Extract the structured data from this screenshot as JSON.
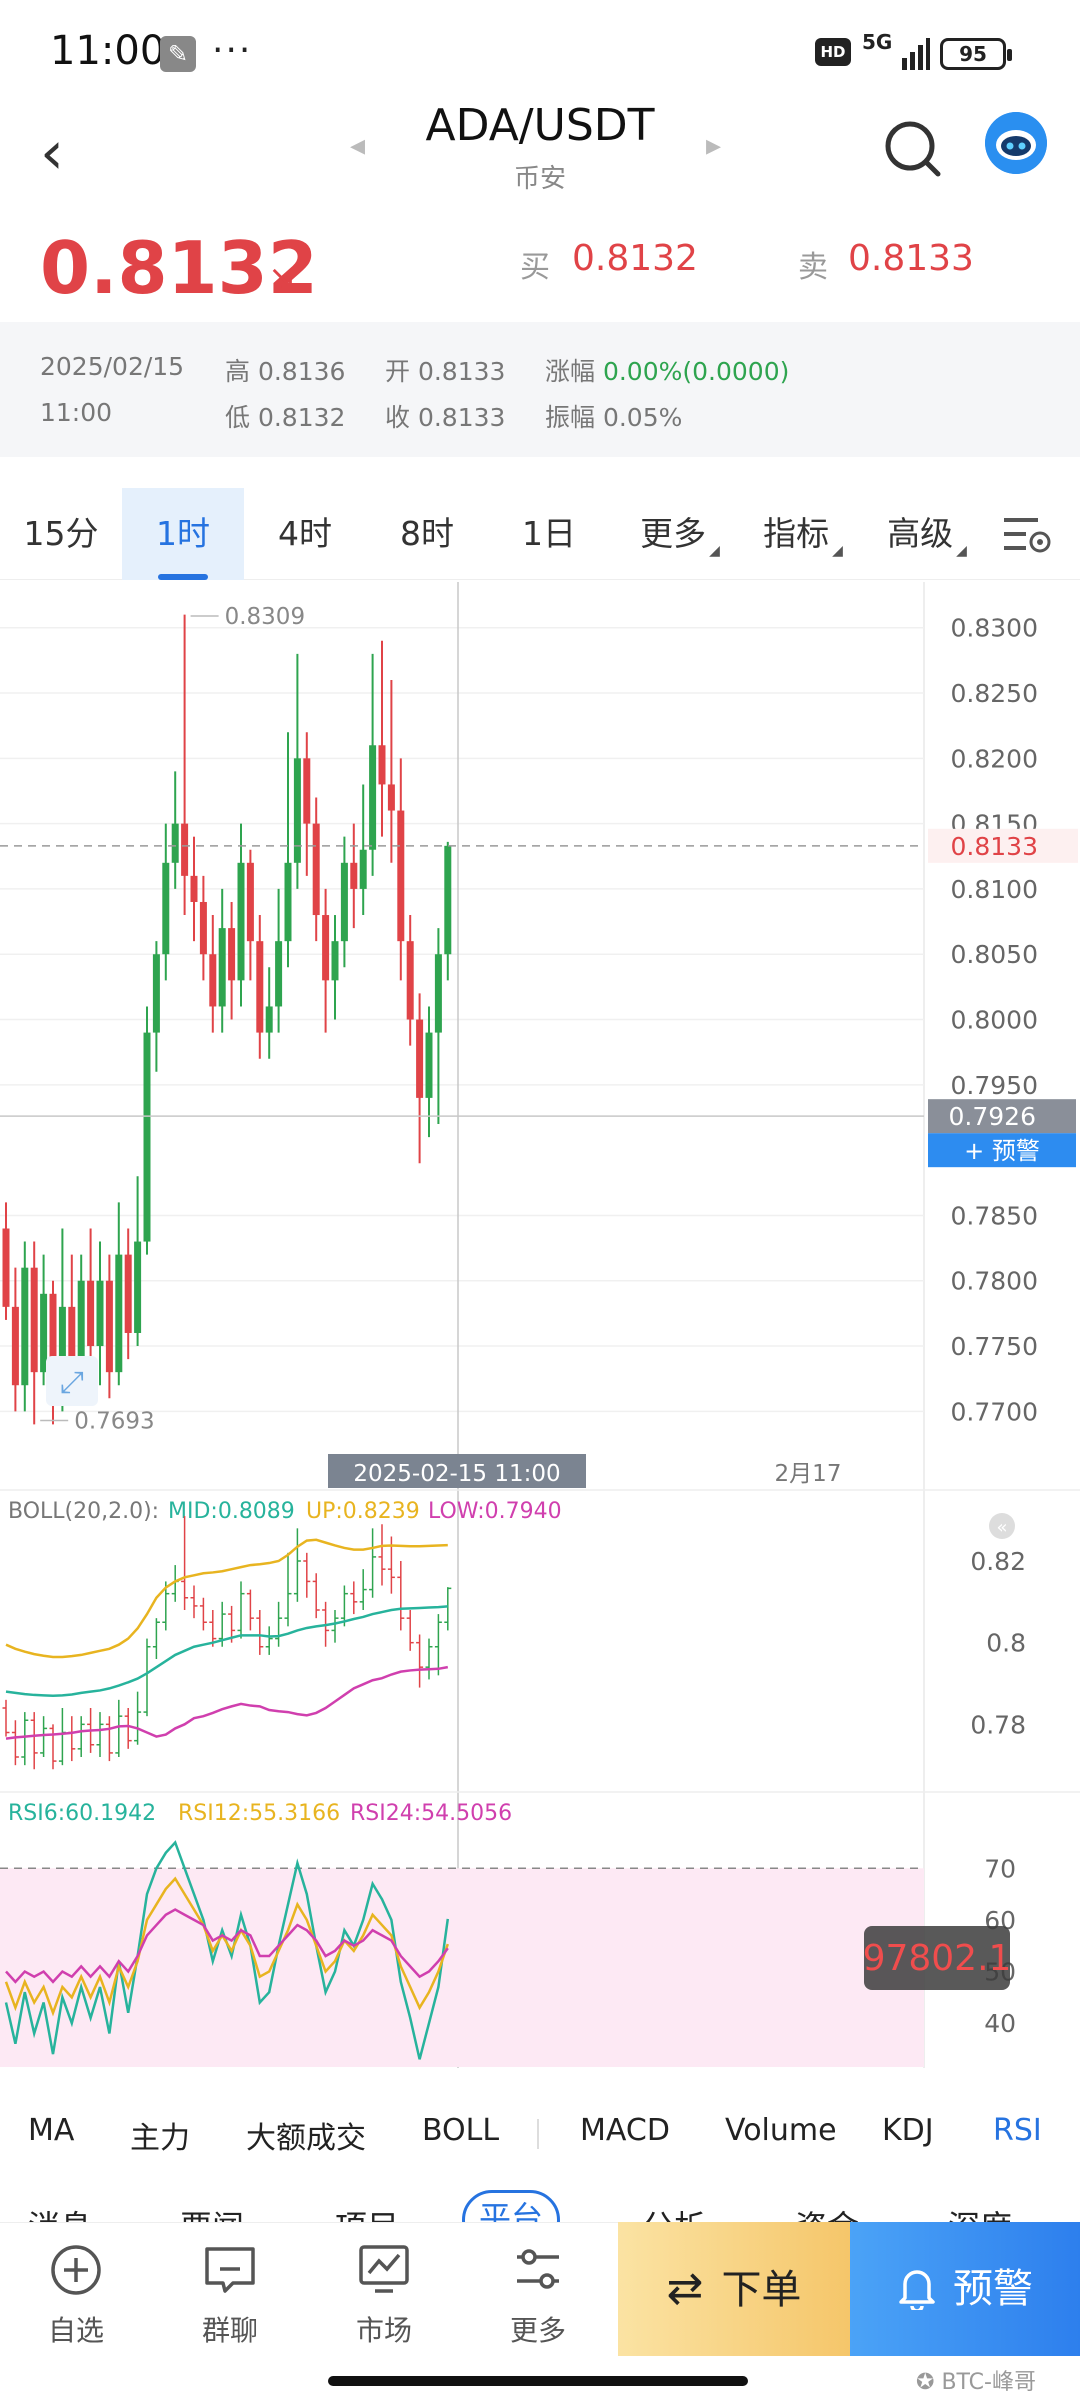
{
  "status_bar": {
    "time": "11:00",
    "dots": "···",
    "hd": "HD",
    "network": "5G",
    "battery": "95"
  },
  "header": {
    "pair": "ADA/USDT",
    "exchange": "币安",
    "back_icon": "chevron-left-icon",
    "search_icon": "search-icon",
    "avatar_icon": "robot-avatar-icon"
  },
  "price": {
    "last": "0.8132",
    "direction": "↘",
    "bid_label": "买",
    "bid": "0.8132",
    "ask_label": "卖",
    "ask": "0.8133"
  },
  "stats": {
    "date": "2025/02/15",
    "time": "11:00",
    "high": "高 0.8136",
    "low": "低 0.8132",
    "open": "开 0.8133",
    "close": "收 0.8133",
    "change_label": "涨幅 ",
    "change_value": "0.00%(0.0000)",
    "amplitude": "振幅 0.05%"
  },
  "timeframes": [
    {
      "label": "15分"
    },
    {
      "label": "1时",
      "active": true
    },
    {
      "label": "4时"
    },
    {
      "label": "8时"
    },
    {
      "label": "1日"
    },
    {
      "label": "更多",
      "dropdown": true
    },
    {
      "label": "指标",
      "dropdown": true
    },
    {
      "label": "高级",
      "dropdown": true
    }
  ],
  "colors": {
    "up": "#2ea44f",
    "down": "#e04347",
    "accent": "#2673e0",
    "boll_mid": "#27b39c",
    "boll_up": "#e8b420",
    "boll_low": "#d03fae",
    "rsi6": "#27b39c",
    "rsi12": "#e8b420",
    "rsi24": "#d03fae"
  },
  "chart_data": [
    {
      "type": "candlestick",
      "title": "",
      "y_ticks": [
        "0.8300",
        "0.8250",
        "0.8200",
        "0.8150",
        "0.8100",
        "0.8050",
        "0.8000",
        "0.7950",
        "0.7850",
        "0.7800",
        "0.7750",
        "0.7700"
      ],
      "ylim": [
        0.7675,
        0.8335
      ],
      "x_labels": [
        "2月17"
      ],
      "last_price_label": "0.8133",
      "crosshair_price_label": "0.7926",
      "crosshair_time_label": "2025-02-15 11:00",
      "max_label": "0.8309",
      "min_label": "0.7693",
      "alert_button": "+ 预警",
      "candles": [
        [
          0.784,
          0.778,
          0.786,
          0.777
        ],
        [
          0.778,
          0.772,
          0.781,
          0.77
        ],
        [
          0.772,
          0.781,
          0.783,
          0.77
        ],
        [
          0.781,
          0.773,
          0.783,
          0.769
        ],
        [
          0.773,
          0.779,
          0.782,
          0.772
        ],
        [
          0.779,
          0.771,
          0.78,
          0.769
        ],
        [
          0.771,
          0.778,
          0.784,
          0.77
        ],
        [
          0.778,
          0.774,
          0.782,
          0.771
        ],
        [
          0.774,
          0.78,
          0.782,
          0.772
        ],
        [
          0.78,
          0.775,
          0.784,
          0.773
        ],
        [
          0.775,
          0.78,
          0.783,
          0.772
        ],
        [
          0.78,
          0.773,
          0.782,
          0.771
        ],
        [
          0.773,
          0.782,
          0.786,
          0.772
        ],
        [
          0.782,
          0.776,
          0.784,
          0.774
        ],
        [
          0.776,
          0.783,
          0.788,
          0.775
        ],
        [
          0.783,
          0.799,
          0.801,
          0.782
        ],
        [
          0.799,
          0.805,
          0.806,
          0.796
        ],
        [
          0.805,
          0.812,
          0.815,
          0.803
        ],
        [
          0.812,
          0.815,
          0.819,
          0.81
        ],
        [
          0.815,
          0.811,
          0.831,
          0.808
        ],
        [
          0.811,
          0.809,
          0.814,
          0.806
        ],
        [
          0.809,
          0.805,
          0.811,
          0.803
        ],
        [
          0.805,
          0.801,
          0.808,
          0.799
        ],
        [
          0.801,
          0.807,
          0.81,
          0.799
        ],
        [
          0.807,
          0.803,
          0.809,
          0.8
        ],
        [
          0.803,
          0.812,
          0.815,
          0.801
        ],
        [
          0.812,
          0.806,
          0.813,
          0.803
        ],
        [
          0.806,
          0.799,
          0.808,
          0.797
        ],
        [
          0.799,
          0.801,
          0.804,
          0.797
        ],
        [
          0.801,
          0.806,
          0.81,
          0.799
        ],
        [
          0.806,
          0.812,
          0.822,
          0.804
        ],
        [
          0.812,
          0.82,
          0.828,
          0.81
        ],
        [
          0.82,
          0.815,
          0.822,
          0.811
        ],
        [
          0.815,
          0.808,
          0.817,
          0.806
        ],
        [
          0.808,
          0.803,
          0.81,
          0.799
        ],
        [
          0.803,
          0.806,
          0.808,
          0.8
        ],
        [
          0.806,
          0.812,
          0.814,
          0.804
        ],
        [
          0.812,
          0.81,
          0.815,
          0.807
        ],
        [
          0.81,
          0.813,
          0.818,
          0.808
        ],
        [
          0.813,
          0.821,
          0.828,
          0.811
        ],
        [
          0.821,
          0.818,
          0.829,
          0.814
        ],
        [
          0.818,
          0.816,
          0.826,
          0.812
        ],
        [
          0.816,
          0.806,
          0.82,
          0.803
        ],
        [
          0.806,
          0.8,
          0.808,
          0.798
        ],
        [
          0.8,
          0.794,
          0.802,
          0.789
        ],
        [
          0.794,
          0.799,
          0.801,
          0.791
        ],
        [
          0.799,
          0.805,
          0.807,
          0.792
        ],
        [
          0.805,
          0.8133,
          0.8136,
          0.803
        ]
      ]
    },
    {
      "type": "line",
      "legend": "BOLL(20,2.0):",
      "series_labels": [
        "MID:0.8089",
        "UP:0.8239",
        "LOW:0.7940"
      ],
      "y_ticks": [
        "0.82",
        "0.8",
        "0.78"
      ],
      "ylim": [
        0.772,
        0.832
      ],
      "series": [
        {
          "name": "MID",
          "values": [
            0.788,
            0.7877,
            0.7874,
            0.7872,
            0.7871,
            0.787,
            0.7871,
            0.7873,
            0.7877,
            0.788,
            0.7883,
            0.7888,
            0.7895,
            0.7903,
            0.7912,
            0.7925,
            0.794,
            0.7955,
            0.797,
            0.798,
            0.799,
            0.7995,
            0.8,
            0.8006,
            0.8012,
            0.8018,
            0.8018,
            0.8018,
            0.8015,
            0.8016,
            0.8022,
            0.803,
            0.8036,
            0.804,
            0.8043,
            0.8047,
            0.8052,
            0.8058,
            0.8063,
            0.807,
            0.8075,
            0.808,
            0.8083,
            0.8084,
            0.8085,
            0.8086,
            0.8087,
            0.8089
          ]
        },
        {
          "name": "UP",
          "values": [
            0.7995,
            0.7985,
            0.7978,
            0.7972,
            0.7968,
            0.7965,
            0.7965,
            0.7967,
            0.797,
            0.7975,
            0.798,
            0.7985,
            0.7995,
            0.801,
            0.8035,
            0.807,
            0.811,
            0.8135,
            0.815,
            0.816,
            0.8165,
            0.817,
            0.8172,
            0.8175,
            0.818,
            0.8185,
            0.819,
            0.8192,
            0.8195,
            0.82,
            0.8215,
            0.8235,
            0.825,
            0.8252,
            0.8245,
            0.8238,
            0.8232,
            0.8228,
            0.8228,
            0.8232,
            0.8237,
            0.8238,
            0.8237,
            0.8236,
            0.8236,
            0.8237,
            0.8238,
            0.8239
          ]
        },
        {
          "name": "LOW",
          "values": [
            0.7765,
            0.7768,
            0.777,
            0.7772,
            0.7774,
            0.7775,
            0.7777,
            0.7779,
            0.7783,
            0.7785,
            0.7786,
            0.7789,
            0.7795,
            0.7796,
            0.779,
            0.778,
            0.777,
            0.7775,
            0.779,
            0.78,
            0.7815,
            0.782,
            0.7828,
            0.7837,
            0.7844,
            0.785,
            0.7846,
            0.7844,
            0.7835,
            0.7832,
            0.783,
            0.7825,
            0.7822,
            0.7828,
            0.784,
            0.7856,
            0.7872,
            0.7888,
            0.7898,
            0.7908,
            0.7913,
            0.7922,
            0.7929,
            0.7932,
            0.7934,
            0.7935,
            0.7936,
            0.794
          ]
        }
      ]
    },
    {
      "type": "line",
      "series_labels": [
        "RSI6:60.1942",
        "RSI12:55.3166",
        "RSI24:54.5056"
      ],
      "y_ticks": [
        "70",
        "60",
        "50",
        "40"
      ],
      "ylim": [
        31.5,
        78
      ],
      "overlay_value": "97802.1",
      "series": [
        {
          "name": "RSI6",
          "values": [
            44,
            36,
            46,
            38,
            44,
            34,
            45,
            40,
            47,
            41,
            47,
            38,
            52,
            42,
            53,
            65,
            70,
            73,
            75,
            70,
            65,
            60,
            52,
            58,
            53,
            61,
            55,
            44,
            46,
            55,
            63,
            71,
            65,
            55,
            46,
            50,
            58,
            55,
            60,
            67,
            64,
            60,
            48,
            41,
            33,
            40,
            47,
            60.1942
          ]
        },
        {
          "name": "RSI12",
          "values": [
            48,
            43,
            48,
            44,
            47,
            42,
            47,
            45,
            49,
            45,
            49,
            44,
            51,
            47,
            52,
            60,
            63,
            66,
            68,
            65,
            62,
            59,
            54,
            57,
            54,
            58,
            55,
            49,
            50,
            54,
            58,
            63,
            60,
            55,
            50,
            52,
            56,
            54,
            57,
            61,
            59,
            57,
            51,
            47,
            43,
            46,
            50,
            55.3166
          ]
        },
        {
          "name": "RSI24",
          "values": [
            50,
            48,
            50,
            49,
            50,
            48,
            50,
            49,
            51,
            49,
            51,
            49,
            52,
            50,
            53,
            57,
            59,
            61,
            62,
            61,
            60,
            59,
            56,
            57,
            56,
            58,
            57,
            53,
            53,
            55,
            57,
            59,
            58,
            56,
            53,
            54,
            56,
            55,
            56,
            58,
            57,
            56,
            53,
            51,
            49,
            50,
            52,
            54.5056
          ]
        }
      ]
    }
  ],
  "indicator_tabs": [
    {
      "label": "MA"
    },
    {
      "label": "主力"
    },
    {
      "label": "大额成交"
    },
    {
      "label": "BOLL"
    },
    {
      "label": "MACD"
    },
    {
      "label": "Volume"
    },
    {
      "label": "KDJ"
    },
    {
      "label": "RSI",
      "active": true
    }
  ],
  "sub_tabs": [
    "消息",
    "要闻",
    "项目",
    "平台",
    "分析",
    "资金",
    "深度"
  ],
  "bottom_nav": [
    {
      "label": "自选",
      "icon": "plus-circle-icon"
    },
    {
      "label": "群聊",
      "icon": "chat-icon"
    },
    {
      "label": "市场",
      "icon": "chart-monitor-icon"
    },
    {
      "label": "更多",
      "icon": "sliders-icon"
    }
  ],
  "order_button": {
    "label": "下单"
  },
  "alert_button": {
    "label": "预警"
  },
  "watermark": "BTC-峰哥"
}
